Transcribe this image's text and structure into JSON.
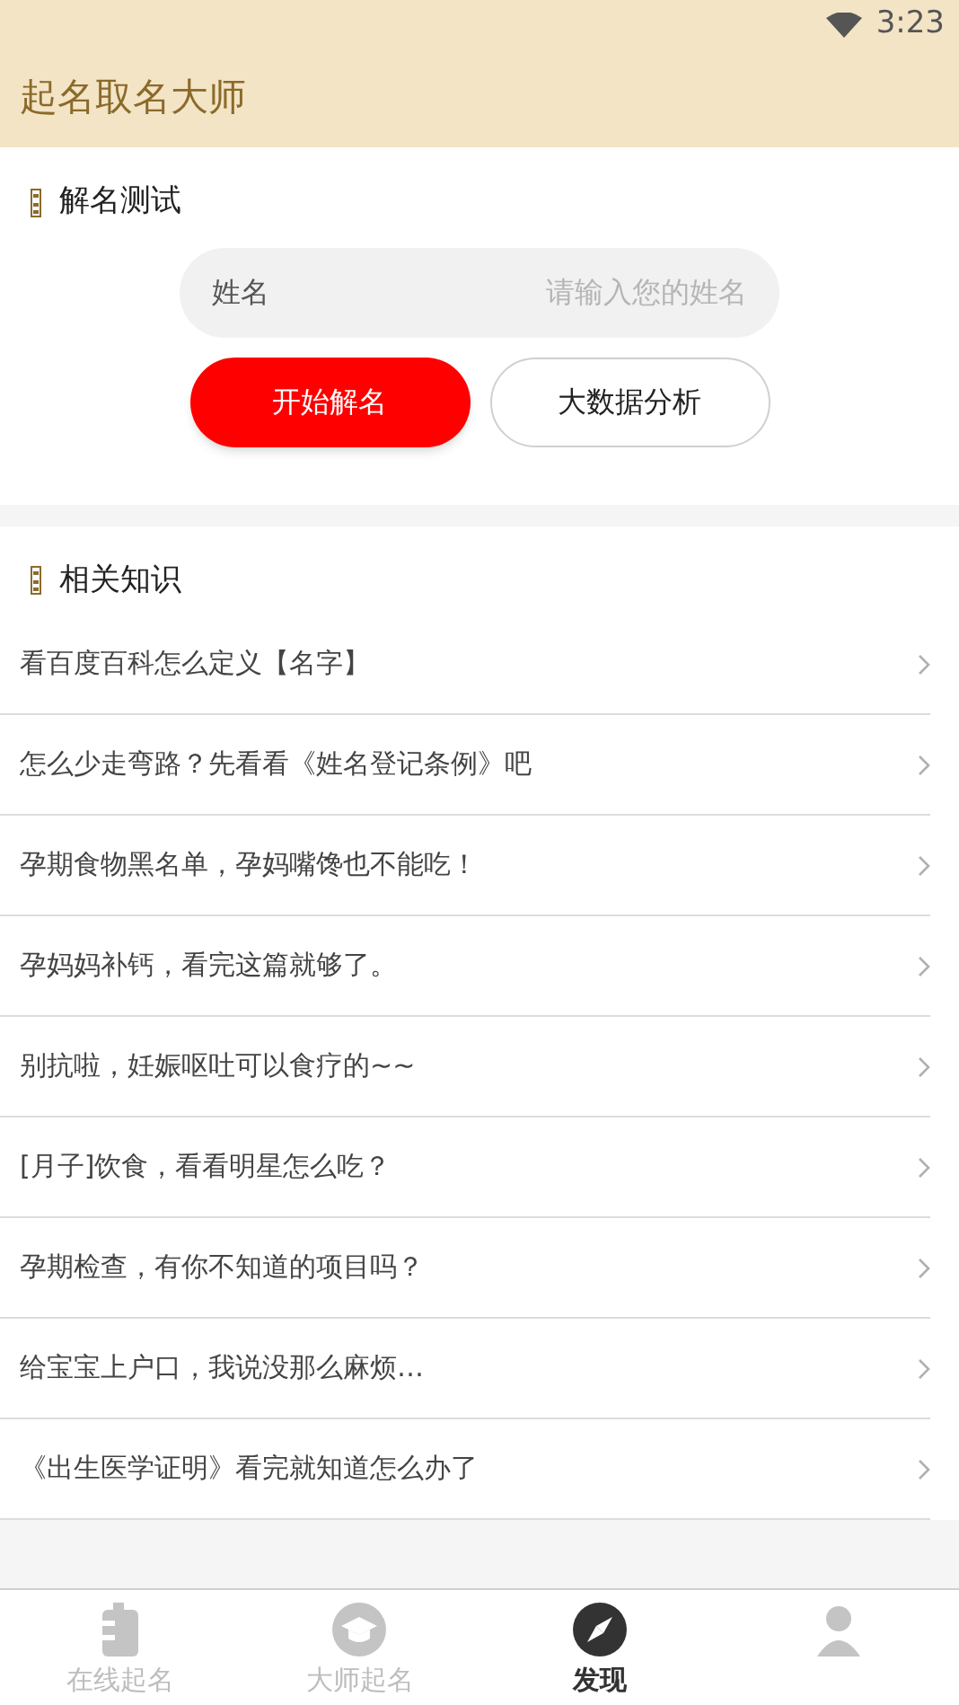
{
  "status_bar": {
    "time": "3:23"
  },
  "app_bar": {
    "title": "起名取名大师"
  },
  "test_section": {
    "title": "解名测试",
    "name_field": {
      "label": "姓名",
      "placeholder": "请输入您的姓名"
    },
    "buttons": [
      {
        "label": "开始解名",
        "kind": "primary"
      },
      {
        "label": "大数据分析",
        "kind": "outline"
      }
    ]
  },
  "knowledge": {
    "title": "相关知识",
    "items": [
      {
        "title": "看百度百科怎么定义【名字】"
      },
      {
        "title": "怎么少走弯路？先看看《姓名登记条例》吧"
      },
      {
        "title": "孕期食物黑名单，孕妈嘴馋也不能吃！"
      },
      {
        "title": "孕妈妈补钙，看完这篇就够了。"
      },
      {
        "title": "别抗啦，妊娠呕吐可以食疗的~~"
      },
      {
        "title": "[月子]饮食，看看明星怎么吃？"
      },
      {
        "title": "孕期检查，有你不知道的项目吗？"
      },
      {
        "title": "给宝宝上户口，我说没那么麻烦…"
      },
      {
        "title": "《出生医学证明》看完就知道怎么办了"
      }
    ]
  },
  "bottom_nav": [
    {
      "label": "在线起名",
      "kind": "book",
      "selected": false
    },
    {
      "label": "大师起名",
      "kind": "cap",
      "selected": false
    },
    {
      "label": "发现",
      "kind": "compass",
      "selected": true
    },
    {
      "kind": "person",
      "selected": false
    }
  ]
}
